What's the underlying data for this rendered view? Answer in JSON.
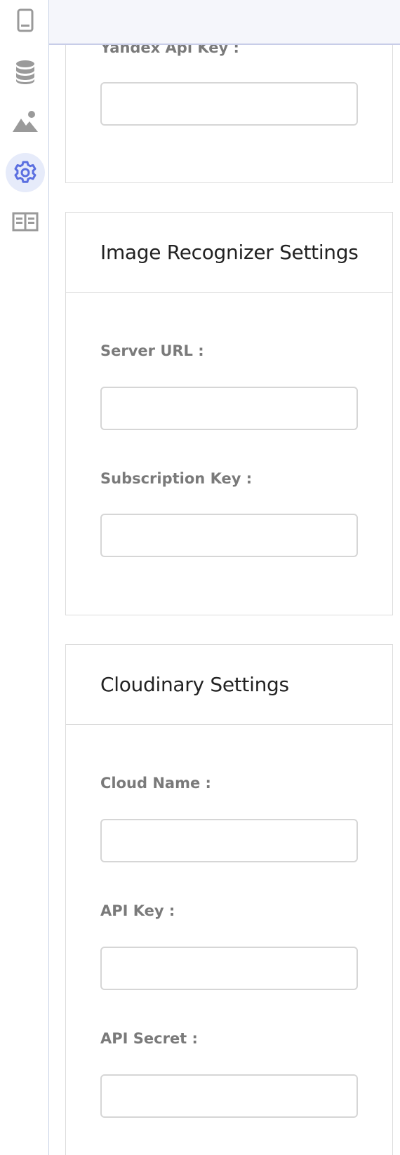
{
  "sidebar": {
    "items": [
      {
        "name": "mobile",
        "icon": "mobile-icon",
        "active": false
      },
      {
        "name": "database",
        "icon": "database-icon",
        "active": false
      },
      {
        "name": "images",
        "icon": "mountain-image-icon",
        "active": false
      },
      {
        "name": "settings",
        "icon": "gear-icon",
        "active": true
      },
      {
        "name": "reader",
        "icon": "book-open-icon",
        "active": false
      }
    ],
    "active_color": "#5b6fe0",
    "icon_color": "#9a9a9a"
  },
  "yandex": {
    "api_key_label": "Yandex Api Key :",
    "api_key_value": ""
  },
  "image_recognizer": {
    "title": "Image Recognizer Settings",
    "server_url_label": "Server URL :",
    "server_url_value": "",
    "subscription_key_label": "Subscription Key :",
    "subscription_key_value": ""
  },
  "cloudinary": {
    "title": "Cloudinary Settings",
    "cloud_name_label": "Cloud Name :",
    "cloud_name_value": "",
    "api_key_label": "API Key :",
    "api_key_value": "",
    "api_secret_label": "API Secret :",
    "api_secret_value": ""
  }
}
